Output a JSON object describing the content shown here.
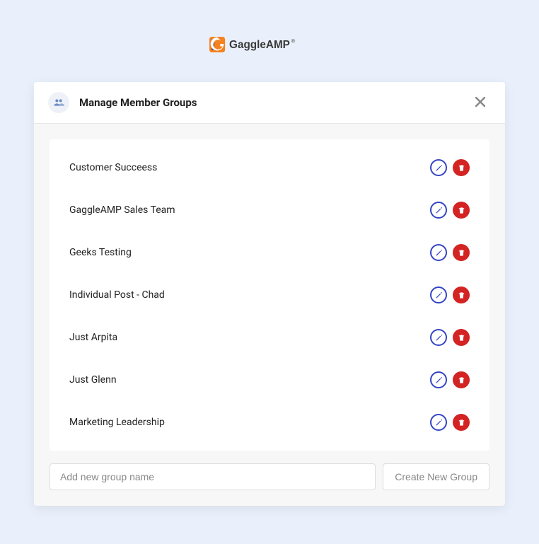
{
  "logo": {
    "text": "GaggleAMP"
  },
  "modal": {
    "title": "Manage Member Groups",
    "close_icon": "close-icon"
  },
  "groups": [
    {
      "name": "Customer Succeess"
    },
    {
      "name": "GaggleAMP Sales Team"
    },
    {
      "name": "Geeks Testing"
    },
    {
      "name": "Individual Post - Chad"
    },
    {
      "name": "Just Arpita"
    },
    {
      "name": "Just Glenn"
    },
    {
      "name": "Marketing Leadership"
    }
  ],
  "footer": {
    "input_placeholder": "Add new group name",
    "create_button_label": "Create New Group"
  }
}
